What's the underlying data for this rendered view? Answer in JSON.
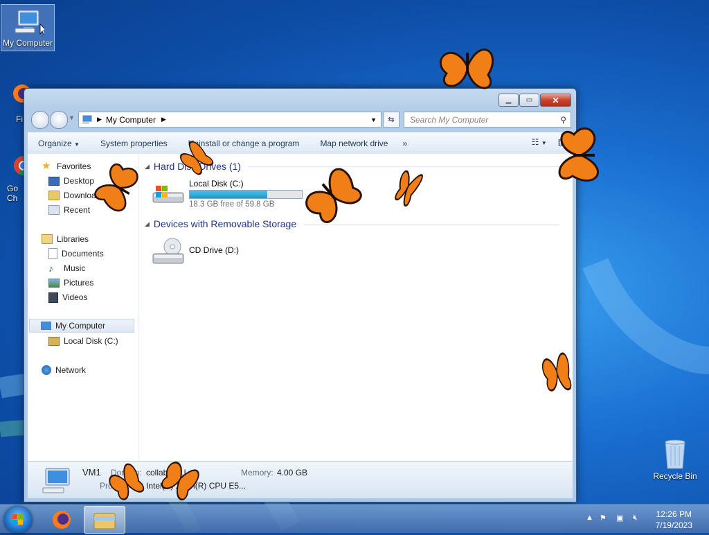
{
  "desktop": {
    "icons": [
      {
        "label": "My Computer"
      },
      {
        "label": "Fi"
      },
      {
        "label": "Go\nCh"
      },
      {
        "label": "Recycle Bin"
      }
    ]
  },
  "window": {
    "address": {
      "path": "My Computer"
    },
    "search": {
      "placeholder": "Search My Computer"
    },
    "toolbar": {
      "organize": "Organize",
      "system_properties": "System properties",
      "uninstall": "Uninstall or change a program",
      "map_drive": "Map network drive",
      "more": "»"
    },
    "nav": {
      "favorites": "Favorites",
      "desktop": "Desktop",
      "downloads": "Downloads",
      "recent": "Recent",
      "libraries": "Libraries",
      "documents": "Documents",
      "music": "Music",
      "pictures": "Pictures",
      "videos": "Videos",
      "my_computer": "My Computer",
      "local_disk": "Local Disk (C:)",
      "network": "Network"
    },
    "groups": {
      "hard_disks": "Hard Disk Drives (1)",
      "removable": "Devices with Removable Storage"
    },
    "drives": {
      "c": {
        "name": "Local Disk (C:)",
        "free": "18.3 GB free of 59.8 GB",
        "used_fraction": 0.694
      },
      "d": {
        "name": "CD Drive (D:)"
      }
    },
    "details": {
      "name": "VM1",
      "domain_label": "Domain:",
      "domain_value": "collabne...l",
      "memory_label": "Memory:",
      "memory_value": "4.00 GB",
      "processor_label": "Processor:",
      "processor_value": "Intel(R) Xeon(R) CPU E5..."
    }
  },
  "taskbar": {
    "time": "12:26 PM",
    "date": "7/19/2023"
  },
  "colors": {
    "desktop": "#1a6fd0",
    "accent": "#1e3287",
    "bar_fill": "#1f96c6"
  }
}
